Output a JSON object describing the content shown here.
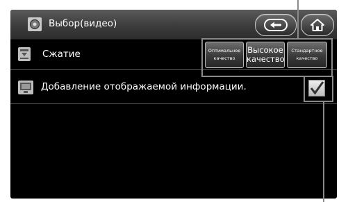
{
  "header": {
    "title": "Выбор(видео)",
    "title_icon": "gear-icon",
    "back_icon": "back-arrow-icon",
    "home_icon": "home-icon"
  },
  "rows": [
    {
      "label": "Сжатие",
      "icon": "compression-icon"
    },
    {
      "label": "Добавление отображаемой информации.",
      "icon": "display-info-icon",
      "checked": true
    }
  ],
  "quality_buttons": [
    {
      "line1": "Оптимальное",
      "line2": "качество"
    },
    {
      "line1": "Высокое",
      "line2": "качество"
    },
    {
      "line1": "Стандартное",
      "line2": "качество"
    }
  ],
  "colors": {
    "screen_bg": "#000000",
    "titlebar": "#4a4a4a",
    "callout": "#8a8a8a"
  }
}
